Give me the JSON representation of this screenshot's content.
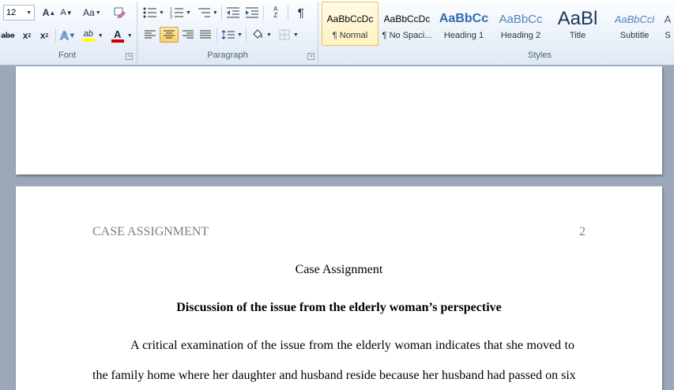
{
  "ribbon": {
    "font": {
      "size": "12",
      "group_label": "Font",
      "grow_font": "A",
      "shrink_font": "A",
      "change_case": "Aa",
      "strike_label": "abe",
      "subscript_label": "x",
      "subscript_mark": "2",
      "superscript_label": "x",
      "superscript_mark": "2",
      "text_effects": "A",
      "highlight": "ab",
      "font_color": "A",
      "highlight_color": "#ffff00",
      "font_color_value": "#d00000"
    },
    "paragraph": {
      "group_label": "Paragraph",
      "pilcrow": "¶",
      "sort_a": "A",
      "sort_z": "Z"
    },
    "styles": {
      "group_label": "Styles",
      "items": [
        {
          "sample": "AaBbCcDc",
          "name": "¶ Normal"
        },
        {
          "sample": "AaBbCcDc",
          "name": "¶ No Spaci..."
        },
        {
          "sample": "AaBbCc",
          "name": "Heading 1"
        },
        {
          "sample": "AaBbCc",
          "name": "Heading 2"
        },
        {
          "sample": "AaBl",
          "name": "Title"
        },
        {
          "sample": "AaBbCcl",
          "name": "Subtitle"
        },
        {
          "sample": "A",
          "name": "S"
        }
      ]
    }
  },
  "document": {
    "running_head": "CASE ASSIGNMENT",
    "page_number": "2",
    "title": "Case Assignment",
    "heading": "Discussion of the issue from the elderly woman’s perspective",
    "line1": "A critical examination of the issue from the elderly woman indicates that she moved to",
    "line2": "the family home where her daughter and husband reside because her husband had passed on six"
  }
}
